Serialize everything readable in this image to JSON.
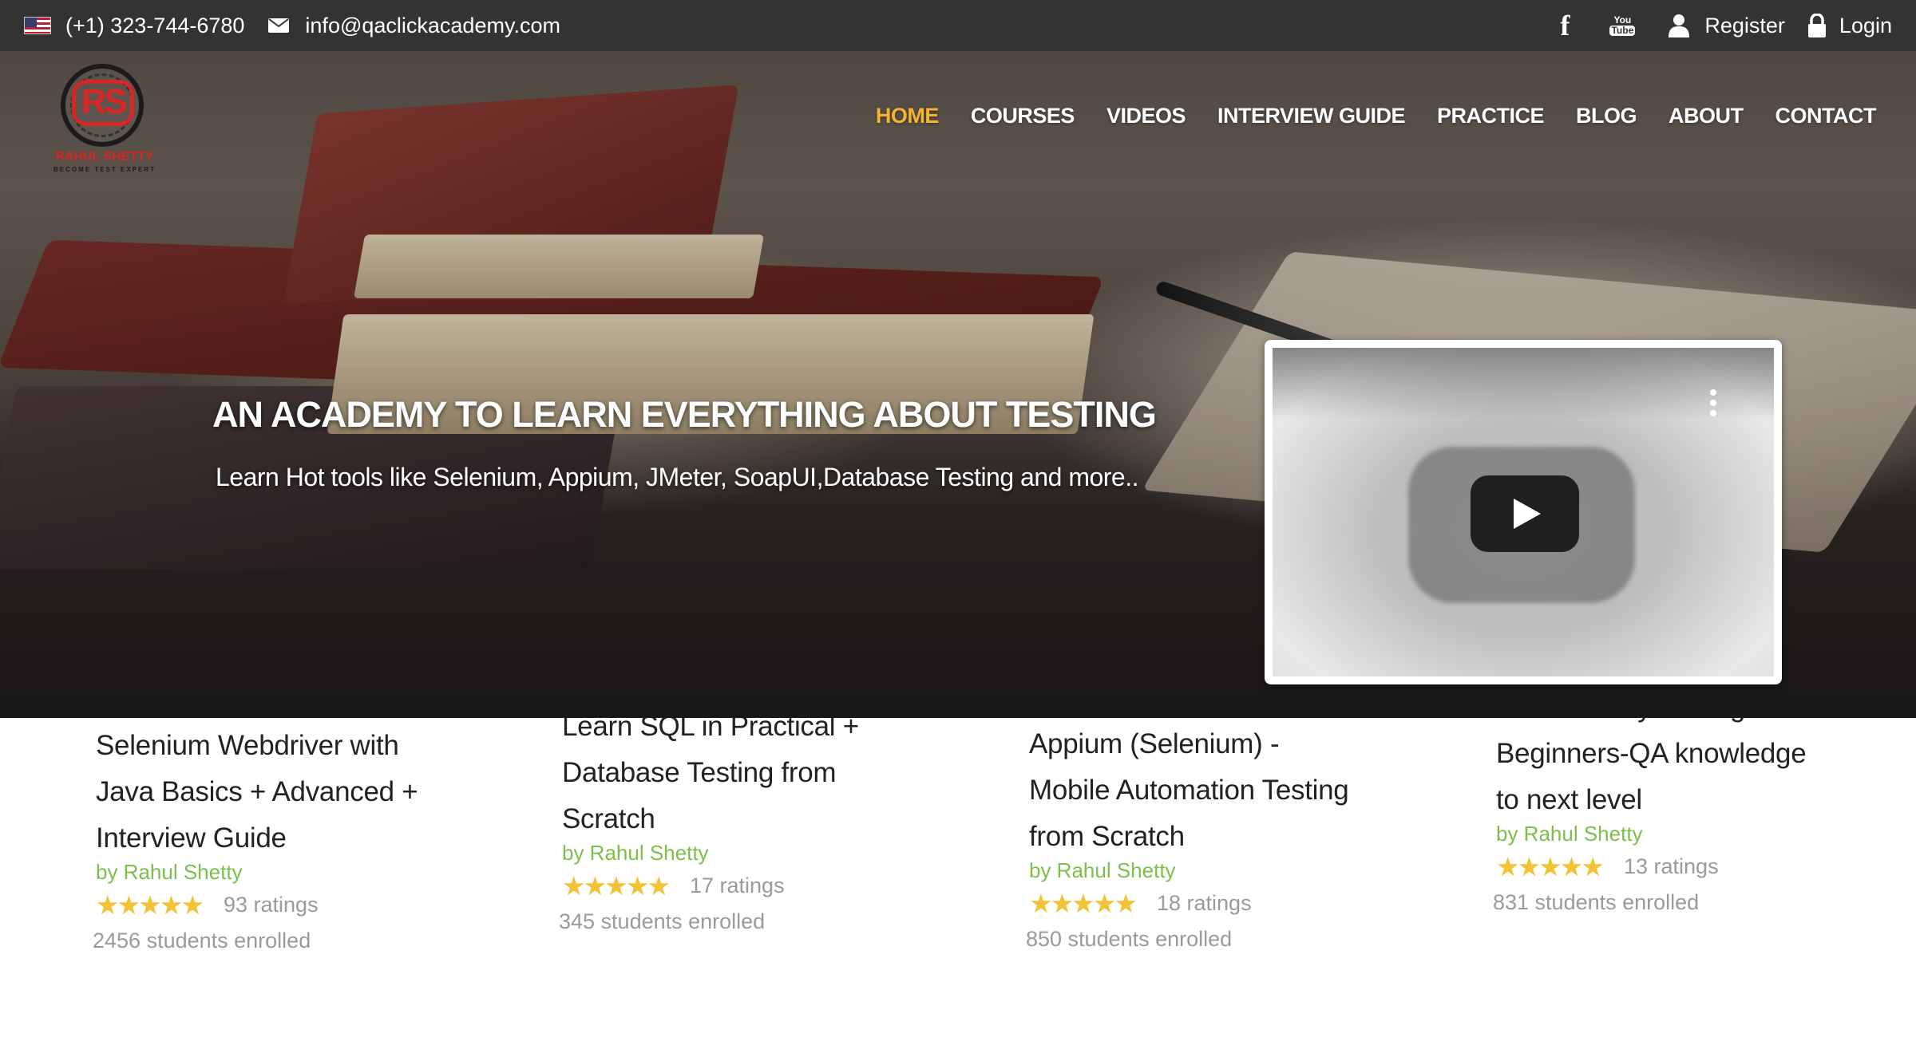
{
  "topbar": {
    "phone": "(+1) 323-744-6780",
    "email": "info@qaclickacademy.com",
    "register_label": "Register",
    "login_label": "Login",
    "icons": [
      "us-flag-icon",
      "envelope-icon",
      "facebook-icon",
      "youtube-icon",
      "user-icon",
      "lock-icon"
    ],
    "youtube_icon_text": [
      "You",
      "Tube"
    ],
    "facebook_glyph": "f"
  },
  "logo": {
    "monogram": "RS",
    "name": "RAHUL SHETTY",
    "tagline": "BECOME TEST EXPERT"
  },
  "nav": {
    "items": [
      {
        "label": "HOME",
        "active": true
      },
      {
        "label": "COURSES",
        "active": false
      },
      {
        "label": "VIDEOS",
        "active": false
      },
      {
        "label": "INTERVIEW GUIDE",
        "active": false
      },
      {
        "label": "PRACTICE",
        "active": false
      },
      {
        "label": "BLOG",
        "active": false
      },
      {
        "label": "ABOUT",
        "active": false
      },
      {
        "label": "CONTACT",
        "active": false
      }
    ]
  },
  "hero": {
    "title": "AN ACADEMY TO LEARN EVERYTHING ABOUT TESTING",
    "subtitle": "Learn Hot tools like Selenium, Appium, JMeter, SoapUI,Database Testing and more.."
  },
  "video": {
    "icons": [
      "play-icon",
      "more-vertical-icon"
    ]
  },
  "courses": [
    {
      "title_lines": [
        "Selenium Webdriver with",
        "Java Basics + Advanced +",
        "Interview Guide"
      ],
      "author": "by Rahul Shetty",
      "stars": "★★★★★",
      "rating_value": 5,
      "ratings": "93 ratings",
      "enrolled": "2456 students enrolled"
    },
    {
      "title_lines": [
        "Learn SQL in Practical +",
        "Database Testing from",
        "Scratch"
      ],
      "author": "by Rahul Shetty",
      "stars": "★★★★★",
      "rating_value": 5,
      "ratings": "17 ratings",
      "enrolled": "345 students enrolled"
    },
    {
      "title_lines": [
        "Appium (Selenium) -",
        "Mobile Automation Testing",
        "from Scratch"
      ],
      "author": "by Rahul Shetty",
      "stars": "★★★★★",
      "rating_value": 5,
      "ratings": "18 ratings",
      "enrolled": "850 students enrolled"
    },
    {
      "title_lines": [
        "WebSecurity Testing for",
        "Beginners-QA knowledge",
        "to next level"
      ],
      "author": "by Rahul Shetty",
      "stars": "★★★★★",
      "rating_value": 5,
      "ratings": "13 ratings",
      "enrolled": "831 students enrolled"
    }
  ],
  "colors": {
    "topbar_bg": "#333333",
    "nav_active": "#f5b431",
    "author_green": "#7cbf4a",
    "star_gold": "#f2c237",
    "brand_red": "#d62626"
  }
}
